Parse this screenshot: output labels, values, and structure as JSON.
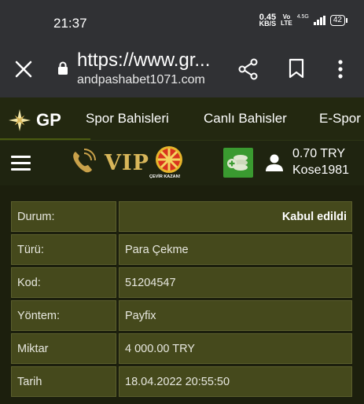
{
  "status_bar": {
    "time": "21:37",
    "net_speed_value": "0.45",
    "net_speed_unit": "KB/S",
    "volte_top": "Vo",
    "volte_bottom": "LTE",
    "network_label": "4.5G",
    "battery": "42"
  },
  "browser": {
    "url_main": "https://www.gr...",
    "url_sub": "andpashabet1071.com"
  },
  "site_nav": {
    "logo": "GP",
    "items": [
      "Spor Bahisleri",
      "Canlı Bahisler",
      "E-Spor"
    ]
  },
  "toolbar": {
    "vip_label": "VIP",
    "wheel_label": "ÇEVİR KAZAN!",
    "balance": "0.70 TRY",
    "username": "Kose1981"
  },
  "transaction": {
    "rows": [
      {
        "label": "Durum:",
        "value": "Kabul edildi"
      },
      {
        "label": "Türü:",
        "value": "Para Çekme"
      },
      {
        "label": "Kod:",
        "value": "51204547"
      },
      {
        "label": "Yöntem:",
        "value": "Payfix"
      },
      {
        "label": "Miktar",
        "value": "4 000.00 TRY"
      },
      {
        "label": "Tarih",
        "value": "18.04.2022 20:55:50"
      }
    ]
  },
  "colors": {
    "chrome_bg": "#303134",
    "page_bg": "#1c1f0d",
    "nav_bg": "#232810",
    "cell_bg": "#45491c",
    "vip_gold": "#d8b65a",
    "cashier_green": "#3a9a30"
  }
}
